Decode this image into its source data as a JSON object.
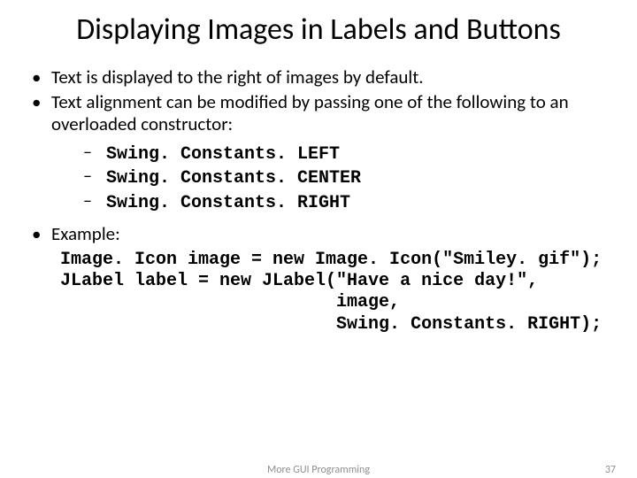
{
  "title": "Displaying Images in Labels and Buttons",
  "bullets": {
    "b1": "Text is displayed to the right of images by default.",
    "b2": "Text alignment can be modified by passing one of the following to an overloaded constructor:",
    "example_label": "Example:"
  },
  "constants": {
    "left": "Swing. Constants. LEFT",
    "center": "Swing. Constants. CENTER",
    "right": "Swing. Constants. RIGHT"
  },
  "code": "Image. Icon image = new Image. Icon(\"Smiley. gif\");\nJLabel label = new JLabel(\"Have a nice day!\",\n                          image,\n                          Swing. Constants. RIGHT);",
  "footer": {
    "center": "More GUI Programming",
    "page": "37"
  }
}
